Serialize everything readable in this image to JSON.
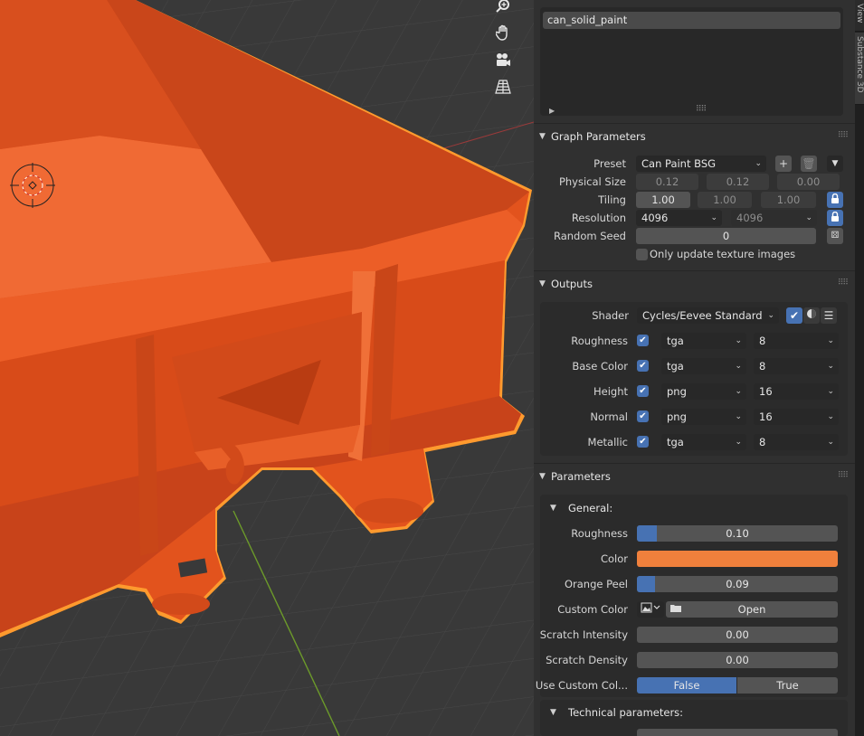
{
  "sidebar_tabs": [
    "Substance 3D",
    "View"
  ],
  "graph_list": {
    "item": "can_solid_paint"
  },
  "graph_parameters": {
    "header": "Graph Parameters",
    "preset_label": "Preset",
    "preset_value": "Can Paint BSG",
    "physical_size_label": "Physical Size",
    "physical_size": [
      "0.12",
      "0.12",
      "0.00"
    ],
    "tiling_label": "Tiling",
    "tiling": [
      "1.00",
      "1.00",
      "1.00"
    ],
    "resolution_label": "Resolution",
    "resolution": [
      "4096",
      "4096"
    ],
    "random_seed_label": "Random Seed",
    "random_seed": "0",
    "only_update_label": "Only update texture images"
  },
  "outputs": {
    "header": "Outputs",
    "shader_label": "Shader",
    "shader_value": "Cycles/Eevee Standard",
    "rows": [
      {
        "name": "Roughness",
        "format": "tga",
        "bits": "8"
      },
      {
        "name": "Base Color",
        "format": "tga",
        "bits": "8"
      },
      {
        "name": "Height",
        "format": "png",
        "bits": "16"
      },
      {
        "name": "Normal",
        "format": "png",
        "bits": "16"
      },
      {
        "name": "Metallic",
        "format": "tga",
        "bits": "8"
      }
    ]
  },
  "parameters": {
    "header": "Parameters",
    "general_label": "General:",
    "roughness_label": "Roughness",
    "roughness": 0.1,
    "roughness_text": "0.10",
    "color_label": "Color",
    "color_value": "#f0803c",
    "orange_peel_label": "Orange Peel",
    "orange_peel": 0.09,
    "orange_peel_text": "0.09",
    "custom_color_label": "Custom Color",
    "open_label": "Open",
    "scratch_intensity_label": "Scratch Intensity",
    "scratch_intensity": "0.00",
    "scratch_density_label": "Scratch Density",
    "scratch_density": "0.00",
    "use_custom_color_label": "Use Custom Col...",
    "false_label": "False",
    "true_label": "True",
    "technical_label": "Technical parameters:"
  },
  "colors": {
    "accent": "#4772b3",
    "object": "#e8501c",
    "outline": "#ff9a2e"
  },
  "icons": {
    "zoom": "zoom-icon",
    "pan": "hand-icon",
    "camera": "camera-icon",
    "grid": "perspective-grid-icon"
  }
}
